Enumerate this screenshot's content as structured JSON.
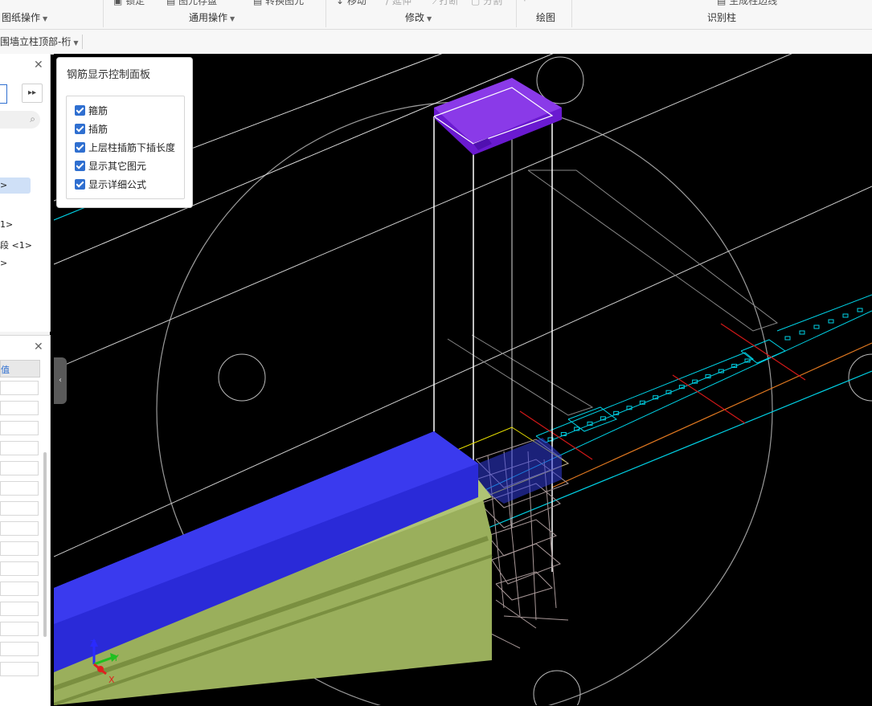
{
  "ribbon": {
    "groups": [
      {
        "label": "图纸操作",
        "items": []
      },
      {
        "label": "通用操作",
        "items": [
          "锁定",
          "图元存盘",
          "转换图元"
        ]
      },
      {
        "label": "修改",
        "items": [
          "移动",
          "延伸",
          "打断",
          "分割"
        ]
      },
      {
        "label": "绘图",
        "items": []
      },
      {
        "label": "识别柱",
        "items": [
          "生成柱边线"
        ]
      }
    ]
  },
  "toolbar2": {
    "floor_select": "围墙立柱顶部-桁"
  },
  "left_panel": {
    "tree_items": [
      "1>",
      "段 <1>",
      ">"
    ],
    "prop_header": "值"
  },
  "rebar_panel": {
    "title": "钢筋显示控制面板",
    "options": [
      {
        "label": "箍筋",
        "checked": true
      },
      {
        "label": "插筋",
        "checked": true
      },
      {
        "label": "上层柱插筋下插长度",
        "checked": true
      },
      {
        "label": "显示其它图元",
        "checked": true
      },
      {
        "label": "显示详细公式",
        "checked": true
      }
    ]
  },
  "axes": {
    "z": "Z",
    "y": "Y",
    "x": "X"
  },
  "colors": {
    "beam_blue": "#2a2ad8",
    "slab_green": "#9aaf5c",
    "cap_purple": "#6a1ad0",
    "cyan_line": "#00d2e6"
  }
}
